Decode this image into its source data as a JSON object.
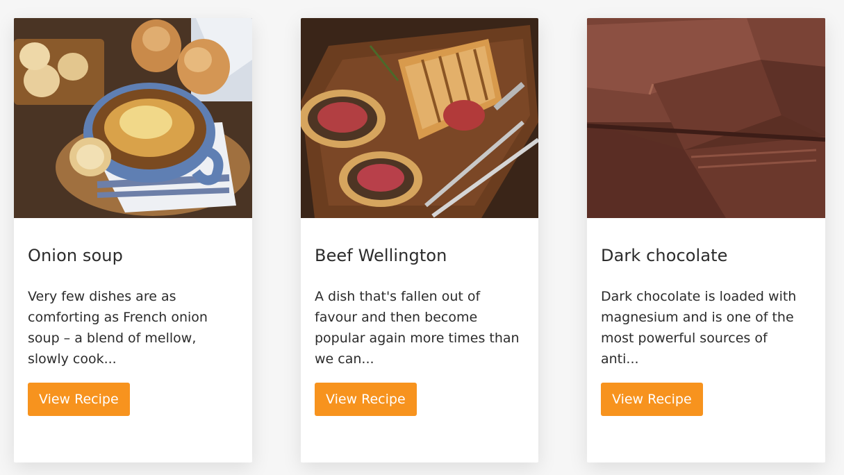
{
  "accent_color": "#f7931e",
  "cards": [
    {
      "image_name": "onion-soup-photo",
      "title": "Onion soup",
      "text": "Very few dishes are as comforting as French onion soup – a blend of mellow, slowly cook...",
      "button_label": "View Recipe"
    },
    {
      "image_name": "beef-wellington-photo",
      "title": "Beef Wellington",
      "text": "A dish that's fallen out of favour and then become popular again more times than we can...",
      "button_label": "View Recipe"
    },
    {
      "image_name": "dark-chocolate-photo",
      "title": "Dark chocolate",
      "text": "Dark chocolate is loaded with magnesium and is one of the most powerful sources of anti...",
      "button_label": "View Recipe"
    }
  ]
}
